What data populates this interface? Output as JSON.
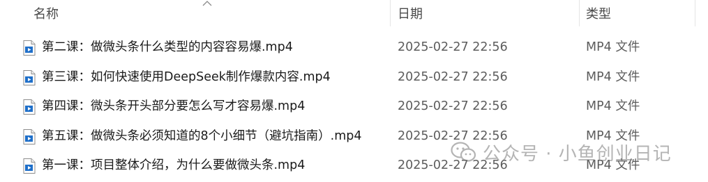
{
  "columns": {
    "name": "名称",
    "date": "日期",
    "type": "类型"
  },
  "files": [
    {
      "name": "第二课：做微头条什么类型的内容容易爆.mp4",
      "date": "2025-02-27 22:56",
      "type": "MP4 文件",
      "icon": "video-file-icon"
    },
    {
      "name": "第三课：如何快速使用DeepSeek制作爆款内容.mp4",
      "date": "2025-02-27 22:56",
      "type": "MP4 文件",
      "icon": "video-file-icon"
    },
    {
      "name": "第四课：微头条开头部分要怎么写才容易爆.mp4",
      "date": "2025-02-27 22:56",
      "type": "MP4 文件",
      "icon": "video-file-icon"
    },
    {
      "name": "第五课：做微头条必须知道的8个小细节（避坑指南）.mp4",
      "date": "2025-02-27 22:56",
      "type": "MP4 文件",
      "icon": "video-file-icon"
    },
    {
      "name": "第一课：项目整体介绍，为什么要做微头条.mp4",
      "date": "2025-02-27 22:56",
      "type": "MP4 文件",
      "icon": "video-file-icon"
    }
  ],
  "watermark": {
    "text": "公众号 · 小鱼创业日记",
    "icon": "wechat-logo-icon"
  }
}
